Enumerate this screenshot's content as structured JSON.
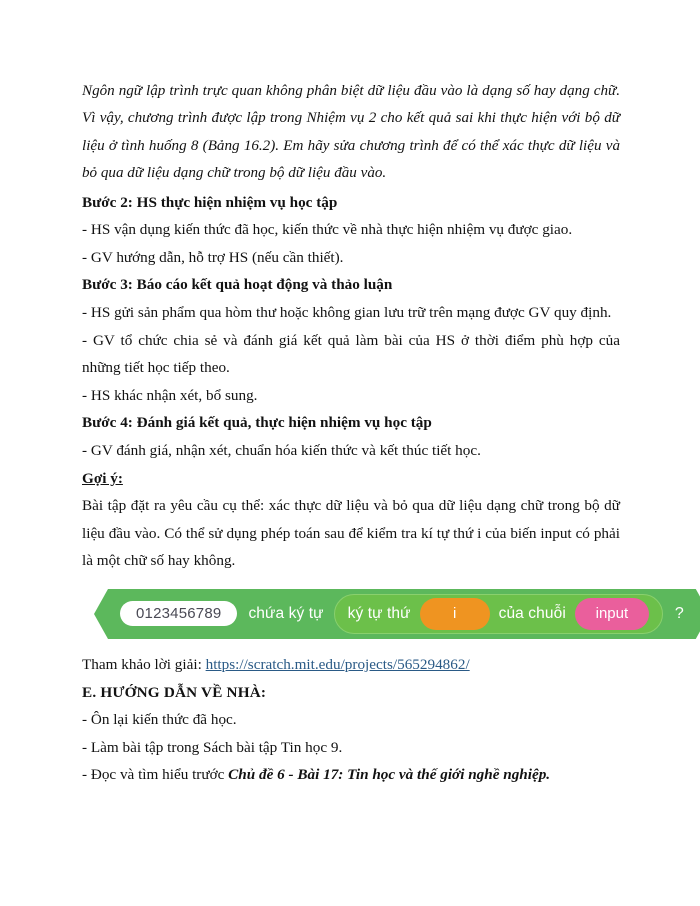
{
  "document": {
    "intro_paragraph": "Ngôn ngữ lập trình trực quan không phân biệt dữ liệu đầu vào là dạng số hay dạng chữ. Vì vậy, chương trình được lập trong Nhiệm vụ 2 cho kết quả sai khi thực hiện với bộ dữ liệu ở tình huống 8 (Bảng 16.2). Em hãy sửa chương trình để có thể xác thực dữ liệu và bỏ qua dữ liệu dạng chữ trong bộ dữ liệu đầu vào.",
    "step2": {
      "heading": "Bước 2: HS thực hiện nhiệm vụ học tập",
      "bullets": [
        "- HS vận dụng kiến thức đã học, kiến thức về nhà thực hiện nhiệm vụ được giao.",
        "- GV hướng dẫn, hỗ trợ HS (nếu cần thiết)."
      ]
    },
    "step3": {
      "heading": "Bước 3: Báo cáo kết quả hoạt động và thảo luận",
      "bullets": [
        "- HS gửi sản phẩm qua hòm thư hoặc không gian lưu trữ trên mạng được GV quy định.",
        "- GV tổ chức chia sẻ và đánh giá kết quả làm bài của HS ở thời điểm phù hợp của những tiết học tiếp theo.",
        "- HS khác nhận xét, bổ sung."
      ]
    },
    "step4": {
      "heading": "Bước 4: Đánh giá kết quả, thực hiện nhiệm vụ học tập",
      "bullets": [
        "- GV đánh giá, nhận xét, chuẩn hóa kiến thức và kết thúc tiết học."
      ]
    },
    "hint": {
      "heading": "Gợi ý:",
      "paragraph": "Bài tập đặt ra yêu cầu cụ thể: xác thực dữ liệu và bỏ qua dữ liệu dạng chữ trong bộ dữ liệu đầu vào. Có thể sử dụng phép toán sau để kiểm tra kí tự thứ i của biến input có phải là một chữ số hay không."
    },
    "scratch_block": {
      "type": "boolean-predicate",
      "value_field": "0123456789",
      "label_contains": "chứa ký tự",
      "inner": {
        "label_letter_of": "ký tự thứ",
        "index_variable": "i",
        "label_of_string": "của chuỗi",
        "string_variable": "input"
      },
      "trailing_symbol": "?",
      "colors": {
        "outer_green": "#5cb85c",
        "inner_green": "#6cc04a",
        "inner_border": "#89d06d",
        "orange_oval": "#ef9421",
        "pink_oval": "#ea5f9c",
        "white_oval": "#ffffff",
        "value_text": "#4a4a55"
      }
    },
    "reference": {
      "prefix": "Tham khảo lời giải: ",
      "link_text": "https://scratch.mit.edu/projects/565294862/",
      "link_color": "#2a5a86"
    },
    "section_e": {
      "heading": "E. HƯỚNG DẪN VỀ NHÀ:",
      "bullets": [
        "- Ôn lại kiến thức đã học.",
        "- Làm bài tập trong Sách bài tập Tin học 9."
      ],
      "last_bullet_prefix": "- Đọc và tìm hiểu trước ",
      "last_bullet_emphasis": "Chủ đề 6 - Bài 17: Tin học và thế giới nghề nghiệp."
    }
  }
}
